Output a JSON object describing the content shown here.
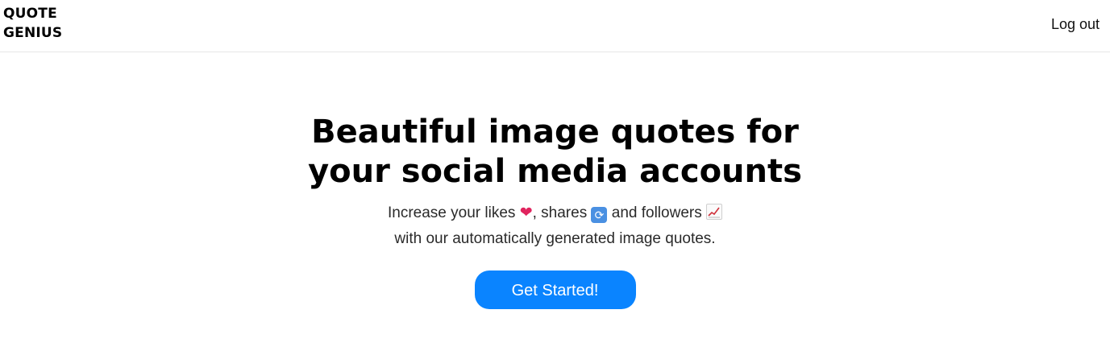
{
  "header": {
    "logo_line1": "QUOTE",
    "logo_line2": "GENIUS",
    "logout_label": "Log out"
  },
  "hero": {
    "headline_line1": "Beautiful image quotes for",
    "headline_line2": "your social media accounts",
    "sub_part1": "Increase your likes ",
    "sub_part2": ", shares ",
    "sub_part3": " and followers ",
    "sub_line2": "with our automatically generated image quotes.",
    "cta_label": "Get Started!"
  },
  "icons": {
    "likes": "heart-emoji",
    "shares": "repeat-emoji",
    "followers": "chart-increasing-emoji"
  },
  "colors": {
    "accent": "#0a84ff",
    "heart": "#e0245e"
  }
}
